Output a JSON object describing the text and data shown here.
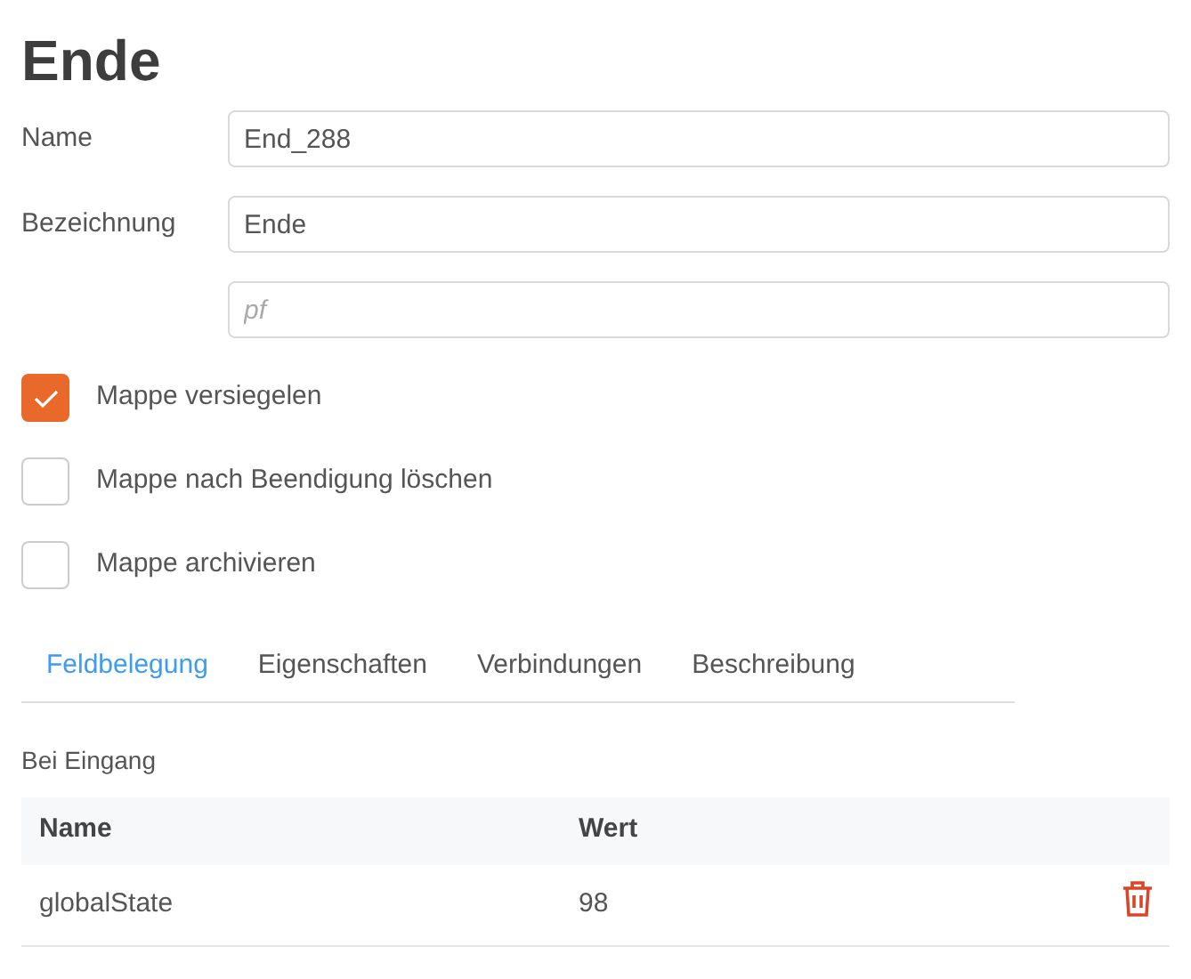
{
  "title": "Ende",
  "fields": [
    {
      "label": "Name",
      "value": "End_288"
    },
    {
      "label": "Bezeichnung",
      "value": "Ende"
    },
    {
      "placeholder": "pf"
    }
  ],
  "checkboxes": [
    {
      "label": "Mappe versiegelen",
      "checked": true
    },
    {
      "label": "Mappe nach Beendigung löschen",
      "checked": false
    },
    {
      "label": "Mappe archivieren",
      "checked": false
    }
  ],
  "tabs": [
    {
      "label": "Feldbelegung",
      "selected": true
    },
    {
      "label": "Eigenschaften",
      "selected": false
    },
    {
      "label": "Verbindungen",
      "selected": false
    },
    {
      "label": "Beschreibung",
      "selected": false
    }
  ],
  "section_label": "Bei Eingang",
  "table": {
    "columns": [
      "Name",
      "Wert"
    ],
    "rows": [
      {
        "name": "globalState",
        "value": "98"
      }
    ]
  }
}
